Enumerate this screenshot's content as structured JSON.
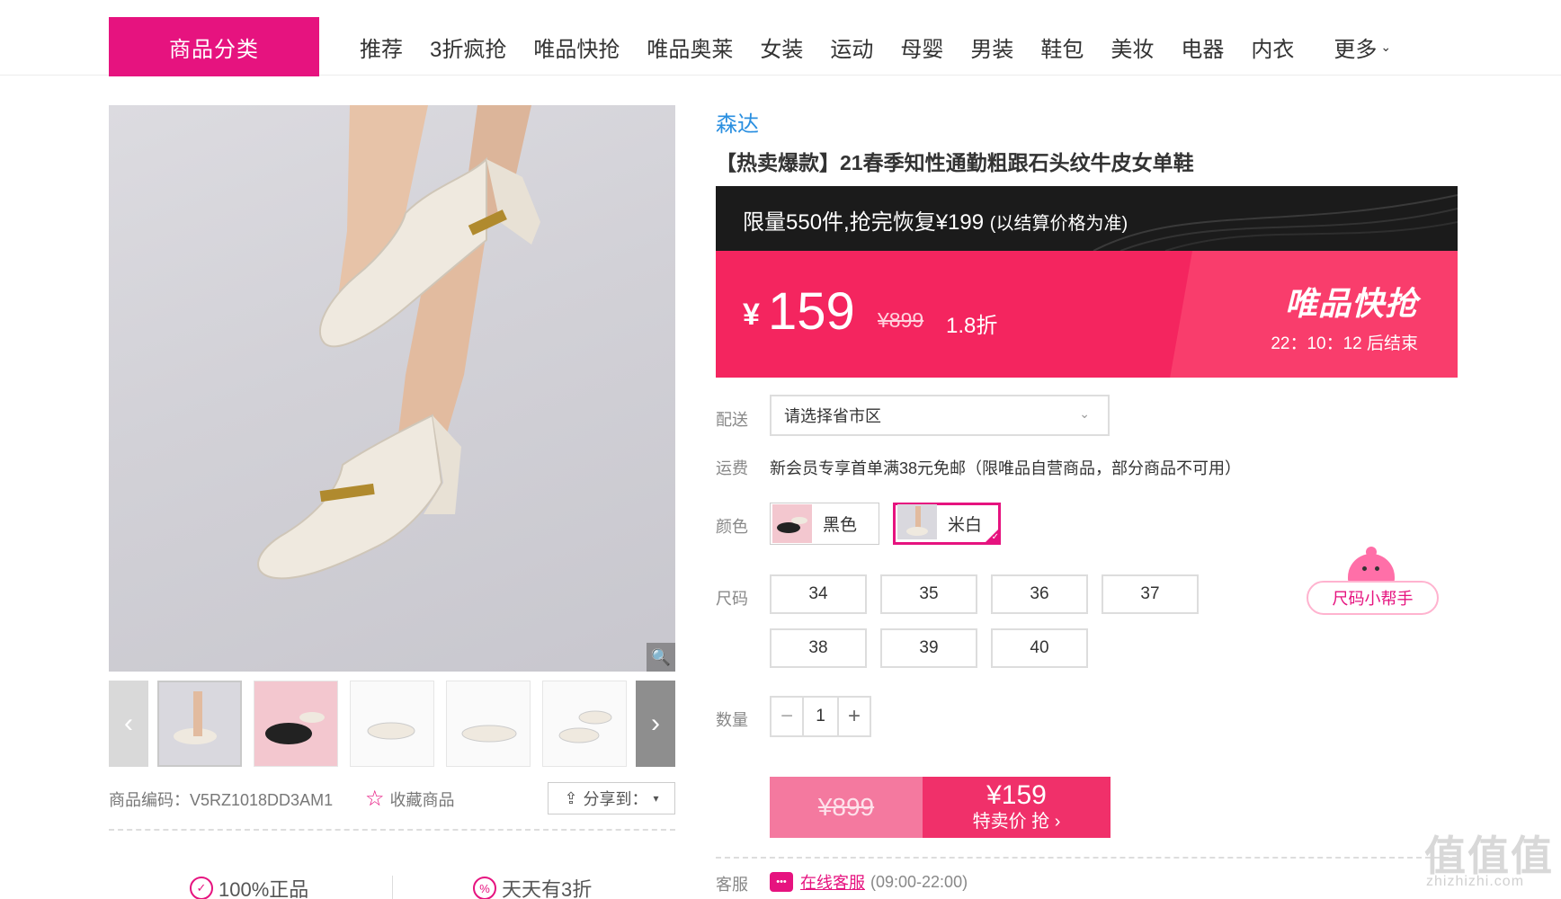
{
  "nav": {
    "category_button": "商品分类",
    "links": [
      "推荐",
      "3折疯抢",
      "唯品快抢",
      "唯品奥莱",
      "女装",
      "运动",
      "母婴",
      "男装",
      "鞋包",
      "美妆",
      "电器",
      "内衣"
    ],
    "more": "更多"
  },
  "product": {
    "brand": "森达",
    "title": "【热卖爆款】21春季知性通勤粗跟石头纹牛皮女单鞋",
    "code_label": "商品编码：",
    "code": "V5RZ1018DD3AM1",
    "favorite": "收藏商品",
    "share": "分享到："
  },
  "promo": {
    "limit_text": "限量550件,抢完恢复¥199",
    "limit_note": "(以结算价格为准)",
    "currency": "¥",
    "price": "159",
    "original_price": "¥899",
    "discount": "1.8折",
    "flash_title": "唯品快抢",
    "countdown": "22：10：12  后结束"
  },
  "options": {
    "delivery_label": "配送",
    "delivery_placeholder": "请选择省市区",
    "shipping_label": "运费",
    "shipping_text": "新会员专享首单满38元免邮（限唯品自营商品，部分商品不可用）",
    "color_label": "颜色",
    "colors": [
      {
        "name": "黑色",
        "selected": false
      },
      {
        "name": "米白",
        "selected": true
      }
    ],
    "size_label": "尺码",
    "sizes": [
      "34",
      "35",
      "36",
      "37",
      "38",
      "39",
      "40"
    ],
    "size_helper": "尺码小帮手",
    "qty_label": "数量",
    "qty_minus": "−",
    "qty_value": "1",
    "qty_plus": "+"
  },
  "buy": {
    "original": "¥899",
    "price": "¥159",
    "action": "特卖价 抢 ›"
  },
  "service": {
    "label": "客服",
    "link": "在线客服",
    "hours": "(09:00-22:00)"
  },
  "guarantees": [
    "100%正品",
    "天天有3折"
  ],
  "watermark": {
    "main": "值值值",
    "sub": "zhizhizhi.com"
  },
  "colors_theme": {
    "accent": "#e6137f",
    "price_red": "#f4255f",
    "brand_blue": "#2a8fe0"
  }
}
